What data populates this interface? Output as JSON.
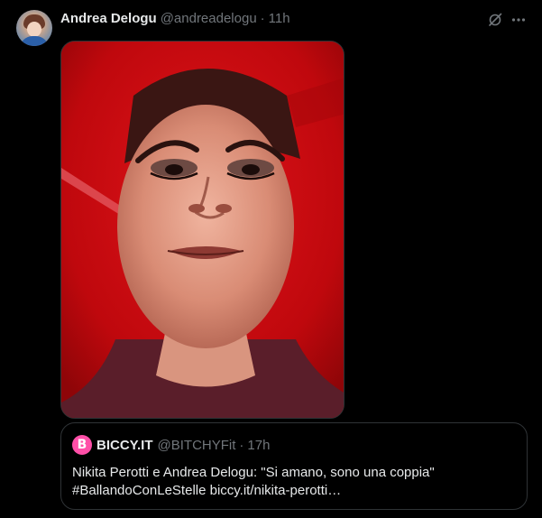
{
  "tweet": {
    "author": {
      "display_name": "Andrea Delogu",
      "handle": "@andreadelogu",
      "separator": "·",
      "time": "11h",
      "avatar_icon": "profile-avatar"
    },
    "actions": {
      "grok_icon": "grok-icon",
      "more_icon": "more-horizontal-icon"
    },
    "media": {
      "type": "video-thumbnail",
      "background_color": "#c4080c"
    },
    "quote": {
      "display_name": "BICCY.IT",
      "avatar_letter": "B",
      "avatar_color": "#ff4fa8",
      "handle": "@BITCHYFit",
      "separator": "·",
      "time": "17h",
      "text_line1": "Nikita Perotti e Andrea Delogu: \"Si amano, sono una coppia\"",
      "text_line2": "#BallandoConLeStelle  biccy.it/nikita-perotti…"
    }
  },
  "colors": {
    "background": "#000000",
    "text_primary": "#e7e9ea",
    "text_secondary": "#71767b",
    "border": "#2f3336"
  }
}
